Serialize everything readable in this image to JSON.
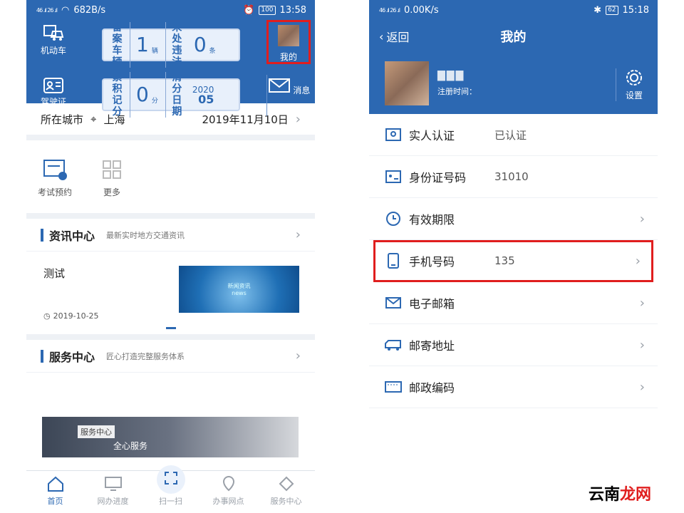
{
  "left_phone": {
    "status_bar": {
      "signal": "46 .ıl 26 .ıl",
      "speed": "682B/s",
      "battery": "100",
      "time": "13:58"
    },
    "header": {
      "vehicle_label": "机动车",
      "license_label": "驾驶证",
      "plate1": {
        "label": "备案车辆",
        "count": "1",
        "unit": "辆",
        "label2": "未处违法",
        "count2": "0",
        "unit2": "条"
      },
      "plate2": {
        "label": "累积记分",
        "count": "0",
        "unit": "分",
        "label2": "清分日期",
        "year": "2020",
        "date": "05"
      },
      "me_label": "我的",
      "msg_label": "消息"
    },
    "city": {
      "label": "所在城市",
      "city": "上海",
      "date": "2019年11月10日"
    },
    "shortcuts": [
      {
        "label": "考试预约"
      },
      {
        "label": "更多"
      }
    ],
    "news_section": {
      "title": "资讯中心",
      "subtitle": "最新实时地方交通资讯"
    },
    "news_item": {
      "title": "测试",
      "date": "2019-10-25",
      "image_text": "新闻资讯\nnews"
    },
    "service_section": {
      "title": "服务中心",
      "subtitle": "匠心打造完整服务体系"
    },
    "service_banner": {
      "tag": "服务中心",
      "text": "全心服务"
    },
    "tabs": [
      {
        "label": "首页"
      },
      {
        "label": "网办进度"
      },
      {
        "label": "扫一扫"
      },
      {
        "label": "办事网点"
      },
      {
        "label": "服务中心"
      }
    ]
  },
  "right_phone": {
    "status_bar": {
      "signal": "46 .ıl 26 .ıl",
      "speed": "0.00K/s",
      "battery": "62",
      "time": "15:18"
    },
    "nav": {
      "back": "返回",
      "title": "我的"
    },
    "profile": {
      "reg_label": "注册时间：",
      "settings_label": "设置"
    },
    "rows": [
      {
        "label": "实人认证",
        "value": "已认证"
      },
      {
        "label": "身份证号码",
        "value": "31010"
      },
      {
        "label": "有效期限",
        "value": ""
      },
      {
        "label": "手机号码",
        "value": "135"
      },
      {
        "label": "电子邮箱",
        "value": ""
      },
      {
        "label": "邮寄地址",
        "value": ""
      },
      {
        "label": "邮政编码",
        "value": ""
      }
    ]
  },
  "watermark": {
    "part1": "云南",
    "part2": "龙网"
  },
  "colors": {
    "brand_blue": "#2c68b2",
    "highlight_red": "#e01e1e"
  }
}
